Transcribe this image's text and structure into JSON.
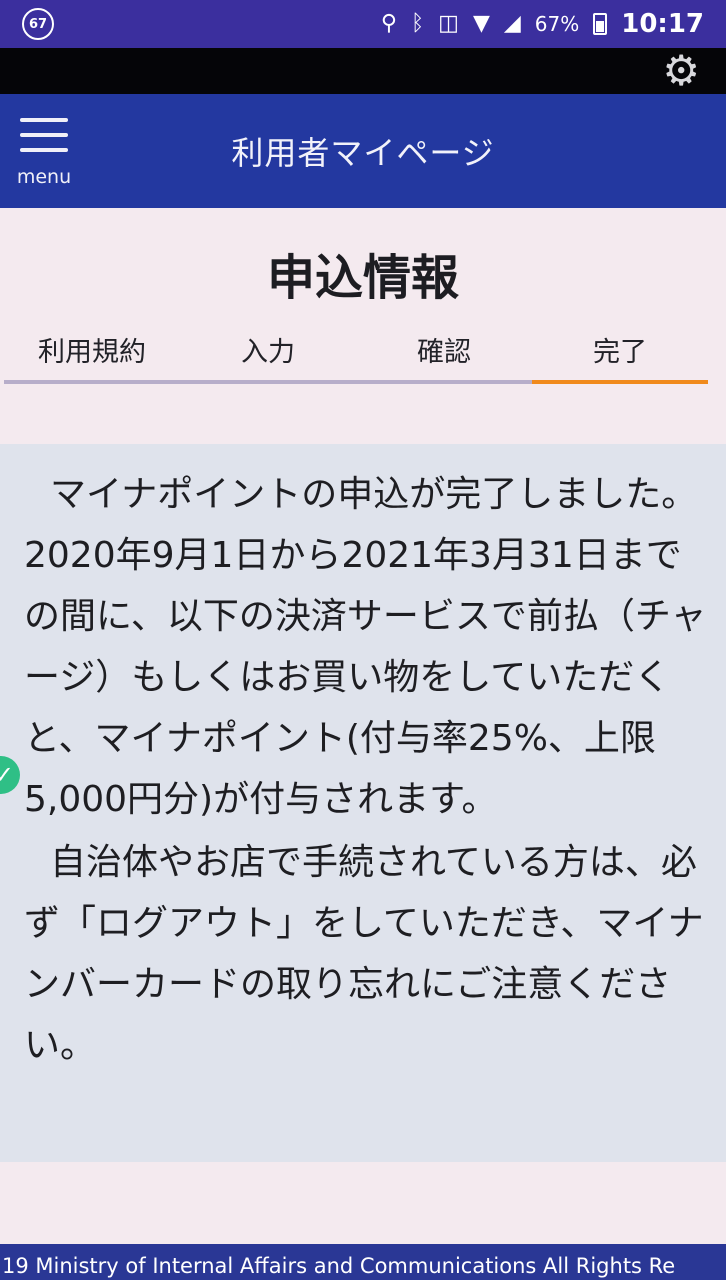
{
  "status_bar": {
    "notification_badge": "67",
    "battery_percent": "67%",
    "time": "10:17",
    "icons": [
      "location-icon",
      "bluetooth-icon",
      "nfc-icon",
      "wifi-icon",
      "signal-icon",
      "battery-icon"
    ]
  },
  "toolbar": {
    "settings_icon": "gear-icon"
  },
  "header": {
    "menu_icon": "hamburger-icon",
    "menu_label": "menu",
    "title": "利用者マイページ"
  },
  "page": {
    "title": "申込情報"
  },
  "steps": [
    {
      "label": "利用規約"
    },
    {
      "label": "入力"
    },
    {
      "label": "確認"
    },
    {
      "label": "完了"
    }
  ],
  "active_step": "完了",
  "message": {
    "paragraph1": "マイナポイントの申込が完了しました。2020年9月1日から2021年3月31日までの間に、以下の決済サービスで前払（チャージ）もしくはお買い物をしていただくと、マイナポイント(付与率25%、上限5,000円分)が付与されます。",
    "paragraph2": "自治体やお店で手続されている方は、必ず「ログアウト」をしていただき、マイナンバーカードの取り忘れにご注意ください。",
    "status_icon": "check-circle-icon"
  },
  "footer": {
    "copyright": "19 Ministry of Internal Affairs and Communications All Rights Re"
  },
  "colors": {
    "status_bar": "#3b2f9e",
    "header": "#2338a0",
    "active_step": "#f08a1c",
    "inactive_step": "#b7aeca",
    "panel": "#dfe3ec",
    "check": "#2fbf86"
  }
}
